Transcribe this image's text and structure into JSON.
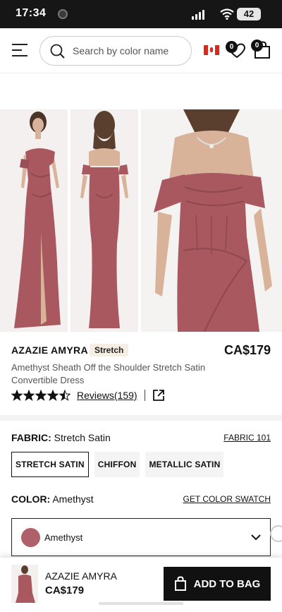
{
  "status_bar": {
    "time": "17:34",
    "battery": "42"
  },
  "header": {
    "search_placeholder": "Search by color name",
    "wishlist_count": "0",
    "bag_count": "0"
  },
  "product": {
    "brand": "AZAZIE AMYRA",
    "tag": "Stretch",
    "price": "CA$179",
    "description": "Amethyst Sheath Off the Shoulder Stretch Satin Convertible Dress",
    "rating": 4.5,
    "reviews_label": "Reviews(159)"
  },
  "fabric": {
    "label": "FABRIC:",
    "value": "Stretch Satin",
    "link": "FABRIC 101",
    "options": [
      "STRETCH SATIN",
      "CHIFFON",
      "METALLIC SATIN"
    ],
    "selected_index": 0
  },
  "color": {
    "label": "COLOR:",
    "value": "Amethyst",
    "link": "GET COLOR SWATCH",
    "selected": "Amethyst",
    "swatch_hex": "#b0606a"
  },
  "bottom_bar": {
    "brand": "AZAZIE AMYRA",
    "price": "CA$179",
    "button": "ADD TO BAG"
  },
  "icons": [
    "menu-icon",
    "search-icon",
    "canada-flag-icon",
    "heart-icon",
    "bag-icon",
    "star-icon",
    "share-icon",
    "chevron-down-icon"
  ],
  "colors": {
    "accent": "#111111",
    "dress": "#b0606a",
    "tag_bg": "#f6ede3"
  }
}
